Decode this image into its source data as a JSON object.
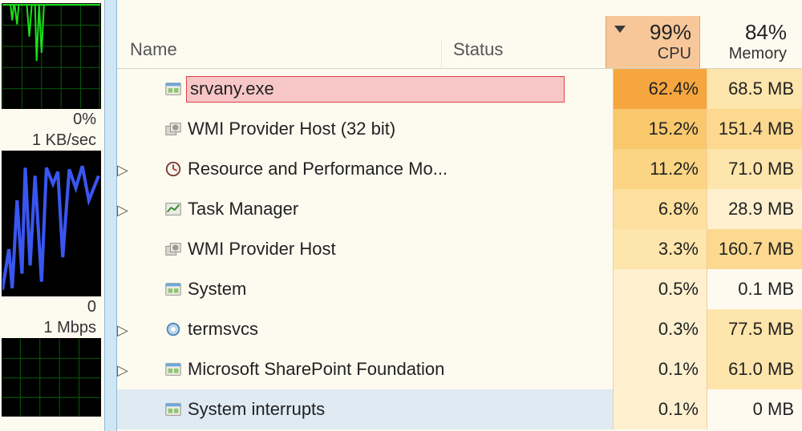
{
  "sidebar": {
    "cpu_label": "0%",
    "disk_label": "1 KB/sec",
    "net_zero": "0",
    "net_label": "1 Mbps"
  },
  "columns": {
    "name": "Name",
    "status": "Status",
    "cpu_total": "99%",
    "cpu_label": "CPU",
    "mem_total": "84%",
    "mem_label": "Memory"
  },
  "heat": {
    "cpu": [
      "#f6a63f",
      "#f9c86d",
      "#fbd484",
      "#fde09e",
      "#fde5ab",
      "#fef0cf",
      "#fef0cf",
      "#fef0cf",
      "#fef0cf"
    ],
    "mem": [
      "#fde5ab",
      "#fcd98f",
      "#fde5ab",
      "#fef0cf",
      "#fcd98f",
      "#fefaf0",
      "#fde5ab",
      "#fde5ab",
      "#fefaf0"
    ]
  },
  "rows": [
    {
      "exp": "",
      "icon": "app",
      "name": "srvany.exe",
      "hl": true,
      "cpu": "62.4%",
      "mem": "68.5 MB",
      "sel": false
    },
    {
      "exp": "",
      "icon": "service",
      "name": "WMI Provider Host (32 bit)",
      "cpu": "15.2%",
      "mem": "151.4 MB",
      "sel": false
    },
    {
      "exp": "▷",
      "icon": "clock",
      "name": "Resource and Performance Mo...",
      "cpu": "11.2%",
      "mem": "71.0 MB",
      "sel": false
    },
    {
      "exp": "▷",
      "icon": "chart",
      "name": "Task Manager",
      "cpu": "6.8%",
      "mem": "28.9 MB",
      "sel": false
    },
    {
      "exp": "",
      "icon": "service",
      "name": "WMI Provider Host",
      "cpu": "3.3%",
      "mem": "160.7 MB",
      "sel": false
    },
    {
      "exp": "",
      "icon": "app",
      "name": "System",
      "cpu": "0.5%",
      "mem": "0.1 MB",
      "sel": false
    },
    {
      "exp": "▷",
      "icon": "gear",
      "name": "termsvcs",
      "cpu": "0.3%",
      "mem": "77.5 MB",
      "sel": false
    },
    {
      "exp": "▷",
      "icon": "app",
      "name": "Microsoft SharePoint Foundation",
      "cpu": "0.1%",
      "mem": "61.0 MB",
      "sel": false
    },
    {
      "exp": "",
      "icon": "app",
      "name": "System interrupts",
      "cpu": "0.1%",
      "mem": "0 MB",
      "sel": true
    }
  ]
}
